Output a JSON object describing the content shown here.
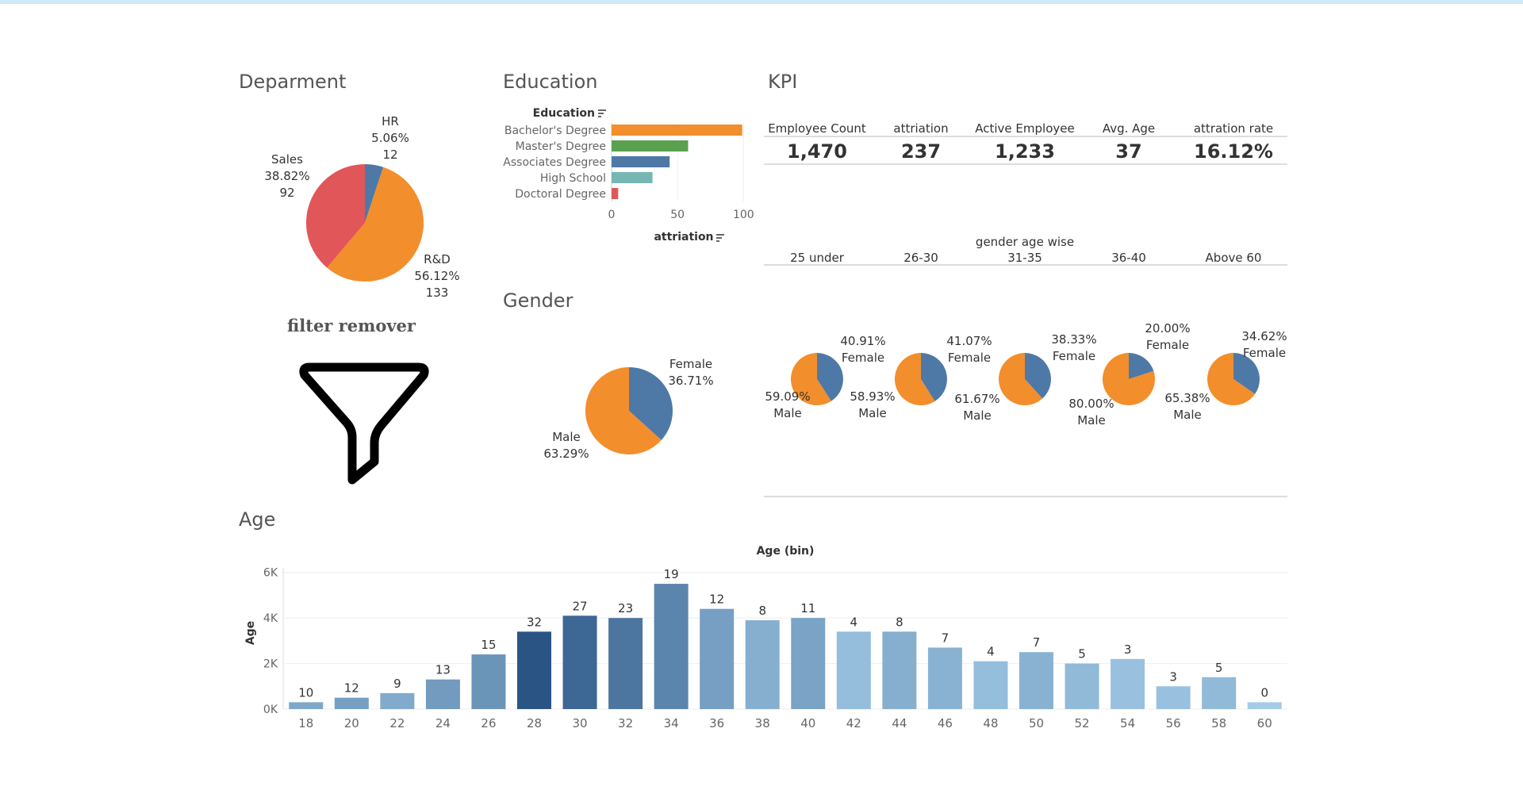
{
  "titles": {
    "department": "Deparment",
    "education": "Education",
    "kpi": "KPI",
    "gender": "Gender",
    "age": "Age",
    "filter": "filter remover"
  },
  "colors": {
    "blue": "#4e79a7",
    "orange": "#f28e2b",
    "red": "#e15759",
    "green": "#59a14f",
    "teal": "#76b7b2",
    "topbar": "#cfe9f9"
  },
  "icons": {
    "filter": "funnel-icon",
    "sort": "sort-icon"
  },
  "chart_data": [
    {
      "id": "department",
      "type": "pie",
      "slices": [
        {
          "label": "HR",
          "percent": "5.06%",
          "value": 12,
          "color": "#4e79a7"
        },
        {
          "label": "R&D",
          "percent": "56.12%",
          "value": 133,
          "color": "#f28e2b"
        },
        {
          "label": "Sales",
          "percent": "38.82%",
          "value": 92,
          "color": "#e15759"
        }
      ]
    },
    {
      "id": "education",
      "type": "bar",
      "orientation": "horizontal",
      "category_header": "Education",
      "xlabel": "attriation",
      "categories": [
        "Bachelor's Degree",
        "Master's Degree",
        "Associates Degree",
        "High School",
        "Doctoral Degree"
      ],
      "values": [
        99,
        58,
        44,
        31,
        5
      ],
      "colors": [
        "#f28e2b",
        "#59a14f",
        "#4e79a7",
        "#76b7b2",
        "#e15759"
      ],
      "xticks": [
        0,
        50,
        100
      ],
      "xlim": [
        0,
        104
      ]
    },
    {
      "id": "kpi",
      "type": "table",
      "columns": [
        "Employee Count",
        "attriation",
        "Active Employee",
        "Avg. Age",
        "attration rate"
      ],
      "values": [
        "1,470",
        "237",
        "1,233",
        "37",
        "16.12%"
      ]
    },
    {
      "id": "gender",
      "type": "pie",
      "slices": [
        {
          "label": "Female",
          "percent": "36.71%",
          "color": "#4e79a7"
        },
        {
          "label": "Male",
          "percent": "63.29%",
          "color": "#f28e2b"
        }
      ]
    },
    {
      "id": "gender_age_wise",
      "type": "pie",
      "title": "gender age wise",
      "groups": [
        {
          "label": "25 under",
          "female": "40.91%",
          "male": "59.09%",
          "female_frac": 0.4091
        },
        {
          "label": "26-30",
          "female": "41.07%",
          "male": "58.93%",
          "female_frac": 0.4107
        },
        {
          "label": "31-35",
          "female": "38.33%",
          "male": "61.67%",
          "female_frac": 0.3833
        },
        {
          "label": "36-40",
          "female": "20.00%",
          "male": "80.00%",
          "female_frac": 0.2
        },
        {
          "label": "Above 60",
          "female": "34.62%",
          "male": "65.38%",
          "female_frac": 0.3462
        }
      ],
      "female_label": "Female",
      "male_label": "Male"
    },
    {
      "id": "age",
      "type": "bar",
      "title": "Age (bin)",
      "ylabel": "Age",
      "categories": [
        "18",
        "20",
        "22",
        "24",
        "26",
        "28",
        "30",
        "32",
        "34",
        "36",
        "38",
        "40",
        "42",
        "44",
        "46",
        "48",
        "50",
        "52",
        "54",
        "56",
        "58",
        "60"
      ],
      "values": [
        300,
        500,
        700,
        1300,
        2400,
        3400,
        4100,
        4000,
        5500,
        4400,
        3900,
        4000,
        3400,
        3400,
        2700,
        2100,
        2500,
        2000,
        2200,
        1000,
        1400,
        300
      ],
      "labels": [
        "10",
        "12",
        "9",
        "13",
        "15",
        "32",
        "27",
        "23",
        "19",
        "12",
        "8",
        "11",
        "4",
        "8",
        "7",
        "4",
        "7",
        "5",
        "3",
        "3",
        "5",
        "0"
      ],
      "yticks": [
        "0K",
        "2K",
        "4K",
        "6K"
      ],
      "ytick_values": [
        0,
        2000,
        4000,
        6000
      ],
      "ylim": [
        0,
        6200
      ]
    }
  ]
}
